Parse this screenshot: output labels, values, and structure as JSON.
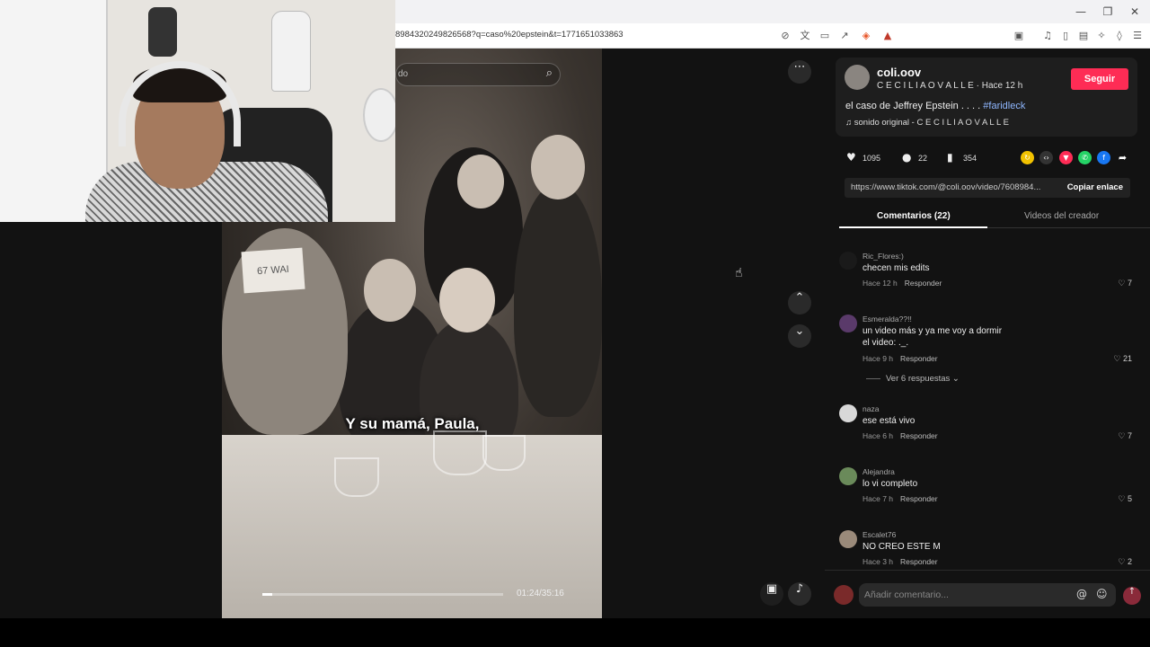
{
  "browser": {
    "url": "8984320249826568?q=caso%20epstein&t=1771651033863",
    "window_controls": [
      "—",
      "❐",
      "✕"
    ]
  },
  "video": {
    "search_placeholder": "do",
    "sign_text": "67 WAI",
    "caption": "Y su mamá, Paula,",
    "time": "01:24/35:16",
    "progress": 0.04
  },
  "creator": {
    "username": "coli.oov",
    "display_name": "C E C I L I A O V A L L E",
    "posted": "Hace 12 h",
    "follow_label": "Seguir",
    "description": "el caso de Jeffrey Epstein . . . .",
    "hashtag": "#faridleck",
    "sound": "sonido original - C E C I L I A O V A L L E"
  },
  "stats": {
    "likes": "1095",
    "comments": "22",
    "saves": "354"
  },
  "share": {
    "link": "https://www.tiktok.com/@coli.oov/video/7608984...",
    "copy_label": "Copiar enlace"
  },
  "tabs": {
    "comments": "Comentarios (22)",
    "creator_videos": "Videos del creador"
  },
  "comments": [
    {
      "name": "Ric_Flores:)",
      "text": "checen mis edits",
      "time": "Hace 12 h",
      "reply": "Responder",
      "likes": "7"
    },
    {
      "name": "Esmeralda??!!",
      "text": "un video más y ya me voy a dormir",
      "text2": "el video: ._.",
      "time": "Hace 9 h",
      "reply": "Responder",
      "likes": "21",
      "replies": "Ver 6 respuestas"
    },
    {
      "name": "naza",
      "text": "ese está vivo",
      "time": "Hace 6 h",
      "reply": "Responder",
      "likes": "7"
    },
    {
      "name": "Alejandra",
      "text": "lo vi completo",
      "time": "Hace 7 h",
      "reply": "Responder",
      "likes": "5"
    },
    {
      "name": "Escalet76",
      "text": "NO CREO ESTE M",
      "time": "Hace 3 h",
      "reply": "Responder",
      "likes": "2"
    }
  ],
  "composer": {
    "placeholder": "Añadir comentario..."
  },
  "colors": {
    "accent": "#fe2c55",
    "hashtag": "#8fb7ff"
  }
}
